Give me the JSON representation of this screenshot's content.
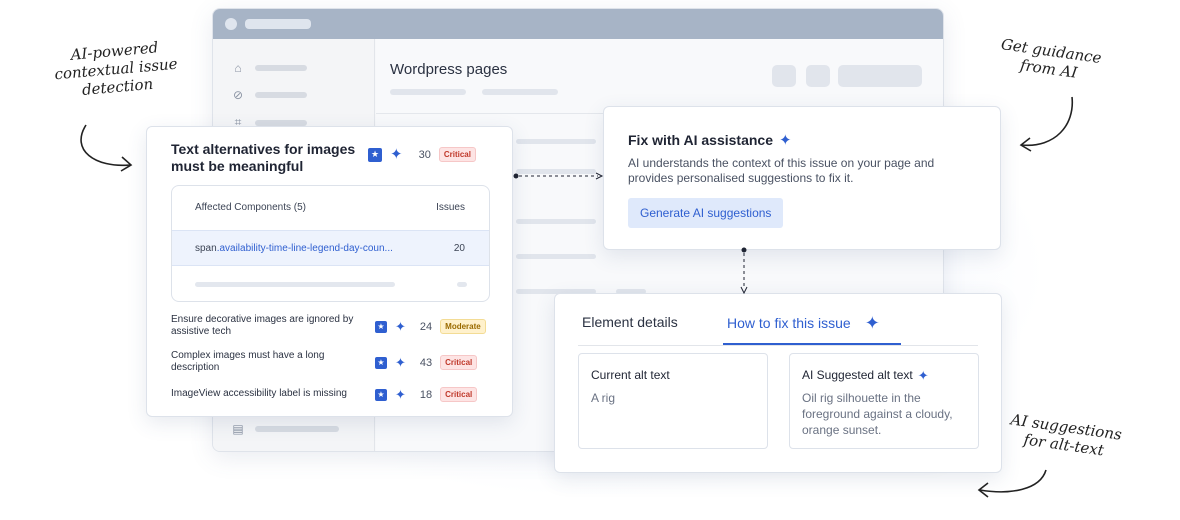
{
  "app": {
    "page_title": "Wordpress pages"
  },
  "issue_card": {
    "title": "Text alternatives for images must be meaningful",
    "count": "30",
    "severity": "Critical",
    "components_header": "Affected Components (5)",
    "issues_header": "Issues",
    "component_selector_prefix": "span",
    "component_selector": ".availability-time-line-legend-day-coun...",
    "component_issue_count": "20",
    "other_issues": [
      {
        "text": "Ensure decorative images are ignored by assistive tech",
        "count": "24",
        "severity": "Moderate"
      },
      {
        "text": "Complex images must have a long description",
        "count": "43",
        "severity": "Critical"
      },
      {
        "text": "ImageView accessibility label is missing",
        "count": "18",
        "severity": "Critical"
      }
    ]
  },
  "fix_card": {
    "title": "Fix with AI assistance",
    "description": "AI understands the context of this issue on your page and provides personalised suggestions to fix it.",
    "button_label": "Generate AI suggestions"
  },
  "details_card": {
    "tabs": [
      "Element details",
      "How to fix this issue"
    ],
    "active_tab": "How to fix this issue",
    "current_label": "Current alt text",
    "current_value": "A rig",
    "suggested_label": "AI Suggested alt text",
    "suggested_value": "Oil rig silhouette in the foreground against a cloudy, orange sunset."
  },
  "annotations": {
    "left": "AI-powered contextual issue detection",
    "top_right": "Get guidance from AI",
    "bottom_right": "AI suggestions for alt-text"
  },
  "icons": {
    "star_badge": "star-icon",
    "sparkle": "ai-sparkle-icon",
    "sidebar": [
      "home-icon",
      "link-icon",
      "layout-icon",
      "document-icon"
    ]
  },
  "colors": {
    "accent": "#2f5fd0",
    "critical_bg": "#fde4e4",
    "critical_text": "#c0392b",
    "moderate_bg": "#fff1cc",
    "moderate_text": "#9a6a00"
  }
}
